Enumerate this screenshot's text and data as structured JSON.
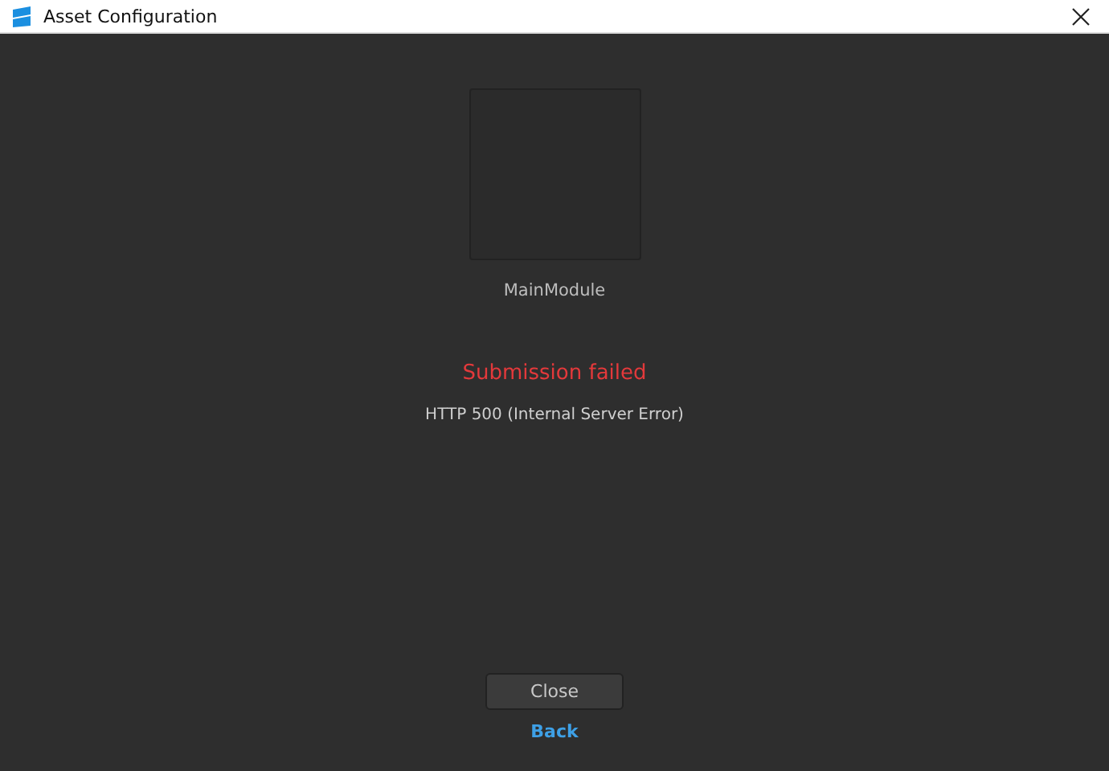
{
  "window": {
    "title": "Asset Configuration"
  },
  "asset": {
    "name": "MainModule"
  },
  "error": {
    "title": "Submission failed",
    "message": "HTTP 500 (Internal Server Error)"
  },
  "buttons": {
    "close": "Close",
    "back": "Back"
  }
}
